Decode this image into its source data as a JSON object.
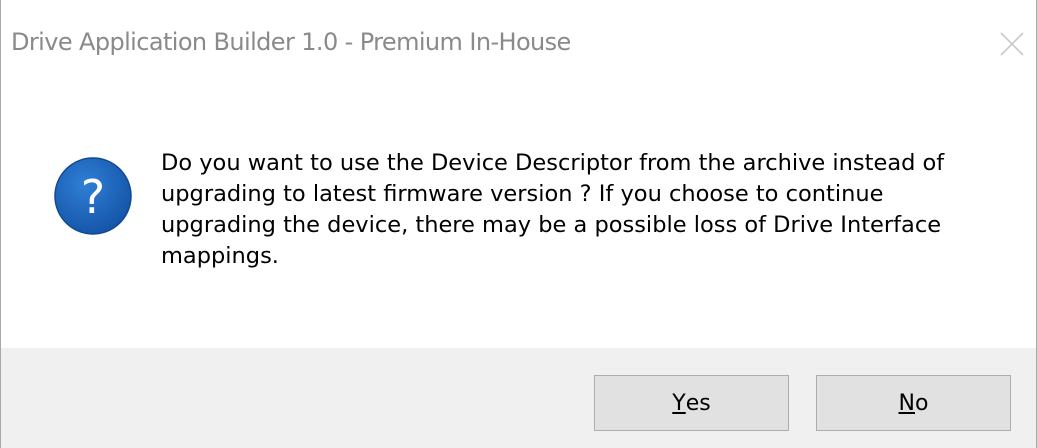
{
  "window": {
    "title": "Drive Application Builder 1.0 - Premium In-House"
  },
  "icons": {
    "close": "close-icon",
    "question": "question-icon",
    "question_color": "#1a5fb4"
  },
  "message": {
    "text": "Do you want to use the Device Descriptor from the archive instead of upgrading to latest firmware version ? If you choose to continue upgrading the device, there may be a possible loss of Drive Interface mappings."
  },
  "buttons": {
    "yes": {
      "mnemonic": "Y",
      "rest": "es"
    },
    "no": {
      "mnemonic": "N",
      "rest": "o"
    }
  }
}
